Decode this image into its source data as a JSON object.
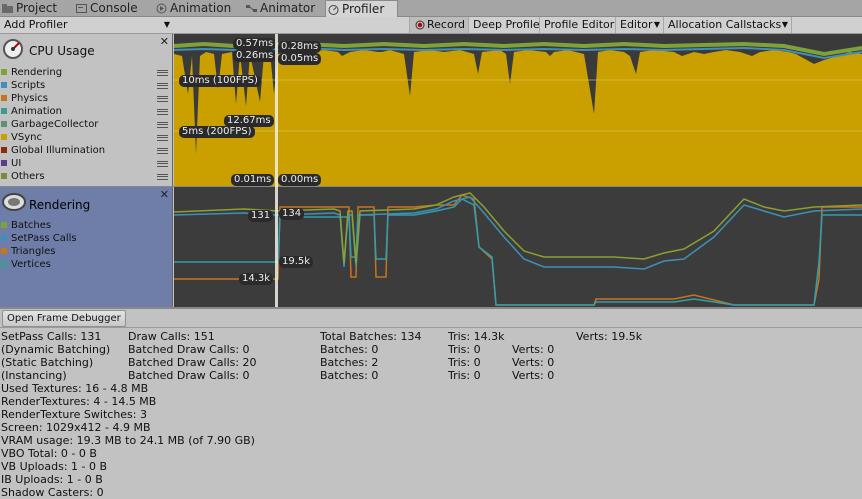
{
  "tabs": [
    {
      "label": "Project",
      "icon": "folder-icon"
    },
    {
      "label": "Console",
      "icon": "console-icon"
    },
    {
      "label": "Animation",
      "icon": "animation-icon"
    },
    {
      "label": "Animator",
      "icon": "animator-icon"
    },
    {
      "label": "Profiler",
      "icon": "profiler-icon",
      "active": true
    }
  ],
  "toolbar": {
    "add_profiler": "Add Profiler",
    "record": "Record",
    "deep_profile": "Deep Profile",
    "profile_editor": "Profile Editor",
    "editor": "Editor",
    "allocation_callstacks": "Allocation Callstacks"
  },
  "cpu": {
    "title": "CPU Usage",
    "items": [
      {
        "label": "Rendering",
        "color": "#7ea23a"
      },
      {
        "label": "Scripts",
        "color": "#3f8fb8"
      },
      {
        "label": "Physics",
        "color": "#c8731e"
      },
      {
        "label": "Animation",
        "color": "#3d9a8f"
      },
      {
        "label": "GarbageCollector",
        "color": "#5d8f7a"
      },
      {
        "label": "VSync",
        "color": "#c8a000"
      },
      {
        "label": "Global Illumination",
        "color": "#8b2b10"
      },
      {
        "label": "UI",
        "color": "#5b3c8a"
      },
      {
        "label": "Others",
        "color": "#7d8a3a"
      }
    ],
    "labels": {
      "l057": "0.57ms",
      "l026": "0.26ms",
      "l028": "0.28ms",
      "l005": "0.05ms",
      "l10": "10ms (100FPS)",
      "l5": "5ms (200FPS)",
      "l1267": "12.67ms",
      "l001": "0.01ms",
      "l000": "0.00ms"
    }
  },
  "rendering": {
    "title": "Rendering",
    "items": [
      {
        "label": "Batches",
        "color": "#7ea23a"
      },
      {
        "label": "SetPass Calls",
        "color": "#3f8fb8"
      },
      {
        "label": "Triangles",
        "color": "#c8731e"
      },
      {
        "label": "Vertices",
        "color": "#3d9a8f"
      }
    ],
    "labels": {
      "l131": "131",
      "l134": "134",
      "l195": "19.5k",
      "l143": "14.3k"
    }
  },
  "open_frame_debugger": "Open Frame Debugger",
  "stats": {
    "setpass": "SetPass Calls: 131",
    "draw_calls": "Draw Calls: 151",
    "total_batches": "Total Batches: 134",
    "tris": "Tris: 14.3k",
    "verts": "Verts: 19.5k",
    "dynamic": "(Dynamic Batching)",
    "dyn_batched": "Batched Draw Calls: 0",
    "dyn_batches": "Batches: 0",
    "dyn_tris": "Tris: 0",
    "dyn_verts": "Verts: 0",
    "static": "(Static Batching)",
    "st_batched": "Batched Draw Calls: 20",
    "st_batches": "Batches: 2",
    "st_tris": "Tris: 0",
    "st_verts": "Verts: 0",
    "instancing": "(Instancing)",
    "in_batched": "Batched Draw Calls: 0",
    "in_batches": "Batches: 0",
    "in_tris": "Tris: 0",
    "in_verts": "Verts: 0",
    "used_textures": "Used Textures: 16 - 4.8 MB",
    "render_textures": "RenderTextures: 4 - 14.5 MB",
    "rt_switches": "RenderTexture Switches: 3",
    "screen": "Screen: 1029x412 - 4.9 MB",
    "vram": "VRAM usage: 19.3 MB to 24.1 MB (of 7.90 GB)",
    "vbo": "VBO Total: 0 - 0 B",
    "vb_uploads": "VB Uploads: 1 - 0 B",
    "ib_uploads": "IB Uploads: 1 - 0 B",
    "shadow_casters": "Shadow Casters: 0"
  }
}
